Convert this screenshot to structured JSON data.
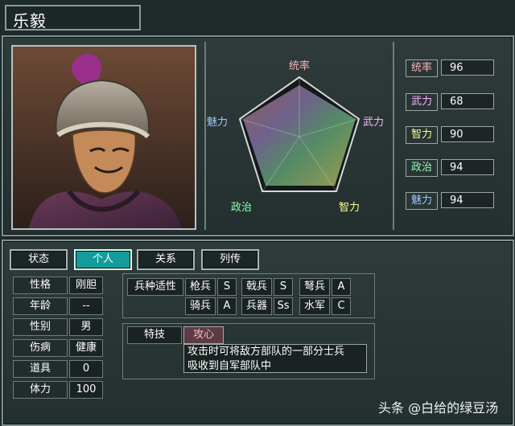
{
  "character": {
    "name": "乐毅"
  },
  "radar": {
    "labels": {
      "top": "统率",
      "right": "武力",
      "bottomRight": "智力",
      "bottomLeft": "政治",
      "left": "魅力"
    }
  },
  "stats": [
    {
      "label": "统率",
      "value": "96",
      "color": "#ffb3b3"
    },
    {
      "label": "武力",
      "value": "68",
      "color": "#f3b8ff"
    },
    {
      "label": "智力",
      "value": "90",
      "color": "#ffff8c"
    },
    {
      "label": "政治",
      "value": "94",
      "color": "#8cffb5"
    },
    {
      "label": "魅力",
      "value": "94",
      "color": "#9cc6ff"
    }
  ],
  "tabs": [
    "状态",
    "个人",
    "关系",
    "列传"
  ],
  "activeTab": "个人",
  "info": [
    {
      "label": "性格",
      "value": "刚胆"
    },
    {
      "label": "年龄",
      "value": "--"
    },
    {
      "label": "性别",
      "value": "男"
    },
    {
      "label": "伤病",
      "value": "健康"
    },
    {
      "label": "道具",
      "value": "0"
    },
    {
      "label": "体力",
      "value": "100"
    }
  ],
  "troops": {
    "header": "兵种适性",
    "row1": [
      {
        "name": "枪兵",
        "grade": "S"
      },
      {
        "name": "戟兵",
        "grade": "S"
      },
      {
        "name": "弩兵",
        "grade": "A"
      }
    ],
    "row2": [
      {
        "name": "骑兵",
        "grade": "A"
      },
      {
        "name": "兵器",
        "grade": "Ss"
      },
      {
        "name": "水军",
        "grade": "C"
      }
    ]
  },
  "skill": {
    "header": "特技",
    "name": "攻心",
    "desc_line1": "攻击时可将敌方部队的一部分士兵",
    "desc_line2": "吸收到自军部队中"
  },
  "watermark": "头条 @白给的绿豆汤",
  "colors": {
    "activeTab": "#149c9c",
    "skillName": "#ffb7c6"
  }
}
